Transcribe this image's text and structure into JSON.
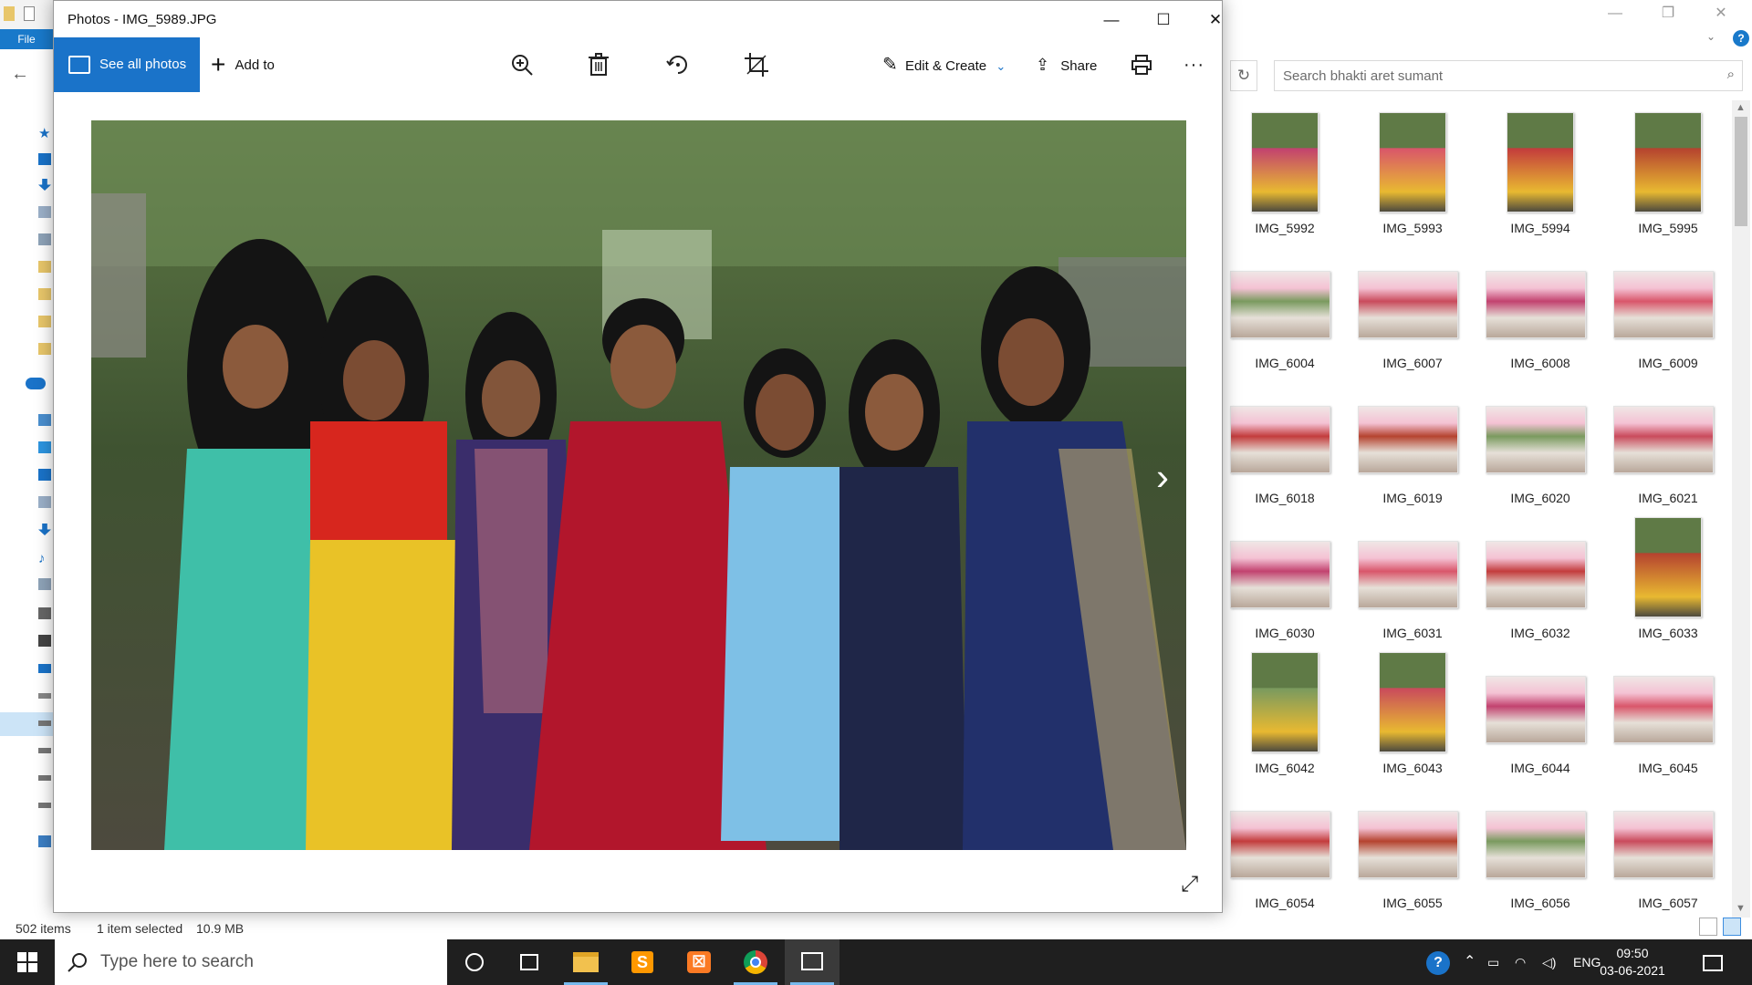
{
  "explorer": {
    "file_tab": "File",
    "search": {
      "placeholder": "Search bhakti aret sumant"
    },
    "status": {
      "items": "502 items",
      "selected": "1 item selected",
      "size": "10.9 MB"
    },
    "thumbnails": [
      {
        "label": "IMG_5992",
        "orientation": "portrait"
      },
      {
        "label": "IMG_5993",
        "orientation": "portrait"
      },
      {
        "label": "IMG_5994",
        "orientation": "portrait"
      },
      {
        "label": "IMG_5995",
        "orientation": "portrait"
      },
      {
        "label": "IMG_6004",
        "orientation": "landscape"
      },
      {
        "label": "IMG_6007",
        "orientation": "landscape"
      },
      {
        "label": "IMG_6008",
        "orientation": "landscape"
      },
      {
        "label": "IMG_6009",
        "orientation": "landscape"
      },
      {
        "label": "IMG_6018",
        "orientation": "landscape"
      },
      {
        "label": "IMG_6019",
        "orientation": "landscape"
      },
      {
        "label": "IMG_6020",
        "orientation": "landscape"
      },
      {
        "label": "IMG_6021",
        "orientation": "landscape"
      },
      {
        "label": "IMG_6030",
        "orientation": "landscape"
      },
      {
        "label": "IMG_6031",
        "orientation": "landscape"
      },
      {
        "label": "IMG_6032",
        "orientation": "landscape"
      },
      {
        "label": "IMG_6033",
        "orientation": "portrait"
      },
      {
        "label": "IMG_6042",
        "orientation": "portrait"
      },
      {
        "label": "IMG_6043",
        "orientation": "portrait"
      },
      {
        "label": "IMG_6044",
        "orientation": "landscape"
      },
      {
        "label": "IMG_6045",
        "orientation": "landscape"
      },
      {
        "label": "IMG_6054",
        "orientation": "landscape"
      },
      {
        "label": "IMG_6055",
        "orientation": "landscape"
      },
      {
        "label": "IMG_6056",
        "orientation": "landscape"
      },
      {
        "label": "IMG_6057",
        "orientation": "landscape"
      }
    ]
  },
  "photos": {
    "title": "Photos - IMG_5989.JPG",
    "toolbar": {
      "see_all": "See all photos",
      "add_to": "Add to",
      "edit_create": "Edit & Create",
      "share": "Share",
      "more": "···"
    }
  },
  "taskbar": {
    "search_placeholder": "Type here to search",
    "lang": "ENG",
    "time": "09:50",
    "date": "03-06-2021"
  },
  "colors": {
    "accent": "#1a73c9",
    "taskbar": "#1f1f1f"
  }
}
